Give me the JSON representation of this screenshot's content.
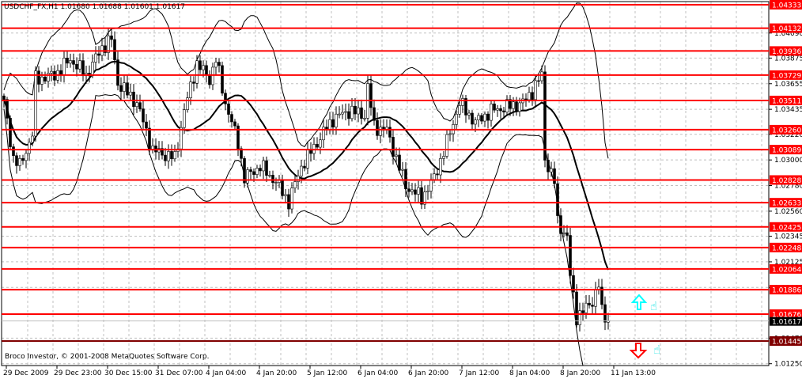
{
  "header": {
    "title": "USDCHF_FX,H1  1.01680 1.01688 1.01601 1.01617",
    "copyright": "Broco Investor, © 2001-2008 MetaQuotes Software Corp."
  },
  "colors": {
    "level": "#ff0000",
    "level_dark": "#800000",
    "bullish_arrow": "#00ffff",
    "bearish_arrow": "#ff0000",
    "current": "#000000"
  },
  "chart_data": {
    "type": "candlestick",
    "symbol": "USDCHF_FX",
    "timeframe": "H1",
    "ohlc_last": {
      "open": 1.0168,
      "high": 1.01688,
      "low": 1.01601,
      "close": 1.01617
    },
    "current_price": "1.01617",
    "ylim": [
      1.0119,
      1.0437
    ],
    "y_ticks": [
      "1.04090",
      "1.03875",
      "1.03655",
      "1.03435",
      "1.03220",
      "1.03000",
      "1.02780",
      "1.02560",
      "1.02345",
      "1.02125",
      "1.01905",
      "1.01470",
      "1.01250"
    ],
    "x_ticks": [
      "29 Dec 2009",
      "29 Dec 23:00",
      "30 Dec 15:00",
      "31 Dec 07:00",
      "4 Jan 04:00",
      "4 Jan 20:00",
      "5 Jan 12:00",
      "6 Jan 04:00",
      "6 Jan 20:00",
      "7 Jan 12:00",
      "8 Jan 04:00",
      "8 Jan 20:00",
      "11 Jan 13:00"
    ],
    "levels": [
      "1.04333",
      "1.04132",
      "1.03936",
      "1.03729",
      "1.03511",
      "1.03260",
      "1.03089",
      "1.02828",
      "1.02633",
      "1.02425",
      "1.02248",
      "1.02064",
      "1.01886",
      "1.01676",
      "1.01445"
    ],
    "indicators": [
      "Moving Average (20)",
      "Bollinger Bands (20, 2)"
    ],
    "close_keypoints_bar_price": [
      [
        0,
        1.0349
      ],
      [
        3,
        1.03015
      ],
      [
        5,
        1.02947
      ],
      [
        9,
        1.03219
      ],
      [
        10,
        1.03694
      ],
      [
        16,
        1.03728
      ],
      [
        21,
        1.03864
      ],
      [
        26,
        1.03728
      ],
      [
        31,
        1.03966
      ],
      [
        34,
        1.04034
      ],
      [
        36,
        1.0366
      ],
      [
        42,
        1.0349
      ],
      [
        47,
        1.03083
      ],
      [
        54,
        1.03015
      ],
      [
        57,
        1.03422
      ],
      [
        61,
        1.0383
      ],
      [
        65,
        1.03694
      ],
      [
        67,
        1.03864
      ],
      [
        70,
        1.0349
      ],
      [
        74,
        1.03151
      ],
      [
        76,
        1.02845
      ],
      [
        81,
        1.02947
      ],
      [
        86,
        1.02811
      ],
      [
        90,
        1.02641
      ],
      [
        94,
        1.02947
      ],
      [
        99,
        1.03151
      ],
      [
        104,
        1.03354
      ],
      [
        109,
        1.03422
      ],
      [
        114,
        1.03388
      ],
      [
        115,
        1.03626
      ],
      [
        117,
        1.03287
      ],
      [
        121,
        1.03253
      ],
      [
        124,
        1.03015
      ],
      [
        127,
        1.02777
      ],
      [
        132,
        1.02675
      ],
      [
        136,
        1.02845
      ],
      [
        140,
        1.03151
      ],
      [
        144,
        1.0349
      ],
      [
        149,
        1.03321
      ],
      [
        154,
        1.03422
      ],
      [
        159,
        1.03456
      ],
      [
        164,
        1.0349
      ],
      [
        167,
        1.03592
      ],
      [
        170,
        1.03728
      ],
      [
        171,
        1.03015
      ],
      [
        174,
        1.02811
      ],
      [
        175,
        1.02471
      ],
      [
        178,
        1.02335
      ],
      [
        179,
        1.02
      ],
      [
        181,
        1.01656
      ],
      [
        184,
        1.01724
      ],
      [
        186,
        1.01792
      ],
      [
        188,
        1.01928
      ],
      [
        189,
        1.0169
      ],
      [
        191,
        1.01617
      ]
    ],
    "signals": [
      {
        "type": "up-arrow",
        "price": 1.0182
      },
      {
        "type": "down-arrow",
        "price": 1.014
      }
    ]
  }
}
